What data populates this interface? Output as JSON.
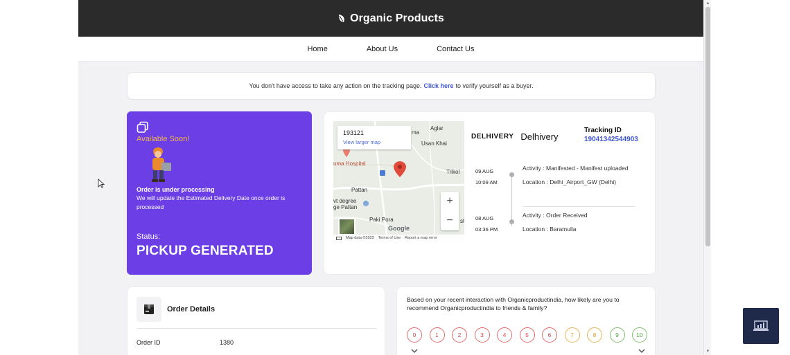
{
  "header": {
    "title": "Organic Products",
    "logo_icon": "leaf-icon"
  },
  "nav": {
    "items": [
      "Home",
      "About Us",
      "Contact Us"
    ]
  },
  "notice": {
    "before": "You don't have access to take any action on the tracking page.",
    "link": "Click here",
    "after": "to verify yourself as a buyer."
  },
  "status_card": {
    "badge": "Available Soon!",
    "processing_title": "Order is under processing",
    "processing_text": "We will update the Estimated Delivery Date once order is processed",
    "status_label": "Status:",
    "status_value": "PICKUP GENERATED",
    "accent": "#6b3ee6"
  },
  "map": {
    "pin_code": "193121",
    "view_larger": "View larger map",
    "labels": [
      "Aglar",
      "Usan Khai",
      "ma",
      "uma Hospital",
      "Trikol",
      "Pattan",
      "vt degree",
      "ge Pattan",
      "Paki Pora",
      "sh"
    ],
    "google": "Google",
    "footer": [
      "Map data ©2022",
      "Terms of Use",
      "Report a map error"
    ],
    "zoom_in": "+",
    "zoom_out": "−"
  },
  "carrier": {
    "brand": "DELHIVERY",
    "name": "Delhivery"
  },
  "tracking": {
    "label": "Tracking ID",
    "value": "19041342544903"
  },
  "timeline": [
    {
      "date": "09 AUG",
      "time": "10:09 AM",
      "activity": "Activity : Manifested - Manifest uploaded",
      "location": "Location : Delhi_Airport_GW (Delhi)"
    },
    {
      "date": "08 AUG",
      "time": "03:36 PM",
      "activity": "Activity : Order Received",
      "location": "Location : Baramulla"
    }
  ],
  "order": {
    "title": "Order Details",
    "id_label": "Order ID",
    "id_value": "1380"
  },
  "survey": {
    "question": "Based on your recent interaction with Organicproductindia, how likely are you to recommend Organicproductindia to friends & family?",
    "scale": [
      "0",
      "1",
      "2",
      "3",
      "4",
      "5",
      "6",
      "7",
      "8",
      "9",
      "10"
    ]
  },
  "colors": {
    "header_bg": "#2b2b2b",
    "link": "#3f57d6",
    "badge": "#f5b544",
    "float_button": "#1f2a4b"
  }
}
